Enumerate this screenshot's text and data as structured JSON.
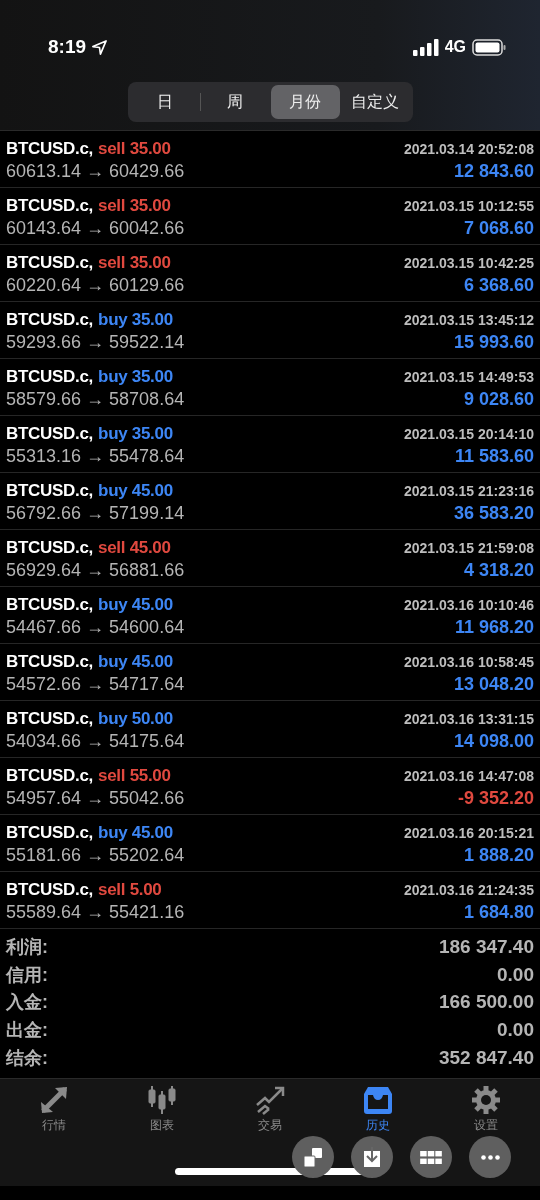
{
  "status_bar": {
    "time": "8:19",
    "network": "4G"
  },
  "period_tabs": [
    {
      "label": "日",
      "selected": false
    },
    {
      "label": "周",
      "selected": false
    },
    {
      "label": "月份",
      "selected": true
    },
    {
      "label": "自定义",
      "selected": false
    }
  ],
  "trades": [
    {
      "symbol": "BTCUSD.c,",
      "kind": "sell",
      "order": "sell 35.00",
      "time": "2021.03.14 20:52:08",
      "prices": "60613.14 → 60429.66",
      "profit": "12 843.60",
      "loss": false
    },
    {
      "symbol": "BTCUSD.c,",
      "kind": "sell",
      "order": "sell 35.00",
      "time": "2021.03.15 10:12:55",
      "prices": "60143.64 → 60042.66",
      "profit": "7 068.60",
      "loss": false
    },
    {
      "symbol": "BTCUSD.c,",
      "kind": "sell",
      "order": "sell 35.00",
      "time": "2021.03.15 10:42:25",
      "prices": "60220.64 → 60129.66",
      "profit": "6 368.60",
      "loss": false
    },
    {
      "symbol": "BTCUSD.c,",
      "kind": "buy",
      "order": "buy 35.00",
      "time": "2021.03.15 13:45:12",
      "prices": "59293.66 → 59522.14",
      "profit": "15 993.60",
      "loss": false
    },
    {
      "symbol": "BTCUSD.c,",
      "kind": "buy",
      "order": "buy 35.00",
      "time": "2021.03.15 14:49:53",
      "prices": "58579.66 → 58708.64",
      "profit": "9 028.60",
      "loss": false
    },
    {
      "symbol": "BTCUSD.c,",
      "kind": "buy",
      "order": "buy 35.00",
      "time": "2021.03.15 20:14:10",
      "prices": "55313.16 → 55478.64",
      "profit": "11 583.60",
      "loss": false
    },
    {
      "symbol": "BTCUSD.c,",
      "kind": "buy",
      "order": "buy 45.00",
      "time": "2021.03.15 21:23:16",
      "prices": "56792.66 → 57199.14",
      "profit": "36 583.20",
      "loss": false
    },
    {
      "symbol": "BTCUSD.c,",
      "kind": "sell",
      "order": "sell 45.00",
      "time": "2021.03.15 21:59:08",
      "prices": "56929.64 → 56881.66",
      "profit": "4 318.20",
      "loss": false
    },
    {
      "symbol": "BTCUSD.c,",
      "kind": "buy",
      "order": "buy 45.00",
      "time": "2021.03.16 10:10:46",
      "prices": "54467.66 → 54600.64",
      "profit": "11 968.20",
      "loss": false
    },
    {
      "symbol": "BTCUSD.c,",
      "kind": "buy",
      "order": "buy 45.00",
      "time": "2021.03.16 10:58:45",
      "prices": "54572.66 → 54717.64",
      "profit": "13 048.20",
      "loss": false
    },
    {
      "symbol": "BTCUSD.c,",
      "kind": "buy",
      "order": "buy 50.00",
      "time": "2021.03.16 13:31:15",
      "prices": "54034.66 → 54175.64",
      "profit": "14 098.00",
      "loss": false
    },
    {
      "symbol": "BTCUSD.c,",
      "kind": "sell",
      "order": "sell 55.00",
      "time": "2021.03.16 14:47:08",
      "prices": "54957.64 → 55042.66",
      "profit": "-9 352.20",
      "loss": true
    },
    {
      "symbol": "BTCUSD.c,",
      "kind": "buy",
      "order": "buy 45.00",
      "time": "2021.03.16 20:15:21",
      "prices": "55181.66 → 55202.64",
      "profit": "1 888.20",
      "loss": false
    },
    {
      "symbol": "BTCUSD.c,",
      "kind": "sell",
      "order": "sell 5.00",
      "time": "2021.03.16 21:24:35",
      "prices": "55589.64 → 55421.16",
      "profit": "1 684.80",
      "loss": false
    }
  ],
  "summary": [
    {
      "label": "利润:",
      "value": "186 347.40"
    },
    {
      "label": "信用:",
      "value": "0.00"
    },
    {
      "label": "入金:",
      "value": "166 500.00"
    },
    {
      "label": "出金:",
      "value": "0.00"
    },
    {
      "label": "结余:",
      "value": "352 847.40"
    }
  ],
  "bottom_tabs": [
    {
      "kind": "quotes",
      "label": "行情",
      "selected": false
    },
    {
      "kind": "chart",
      "label": "图表",
      "selected": false
    },
    {
      "kind": "trade",
      "label": "交易",
      "selected": false
    },
    {
      "kind": "history",
      "label": "历史",
      "selected": true
    },
    {
      "kind": "settings",
      "label": "设置",
      "selected": false
    }
  ]
}
